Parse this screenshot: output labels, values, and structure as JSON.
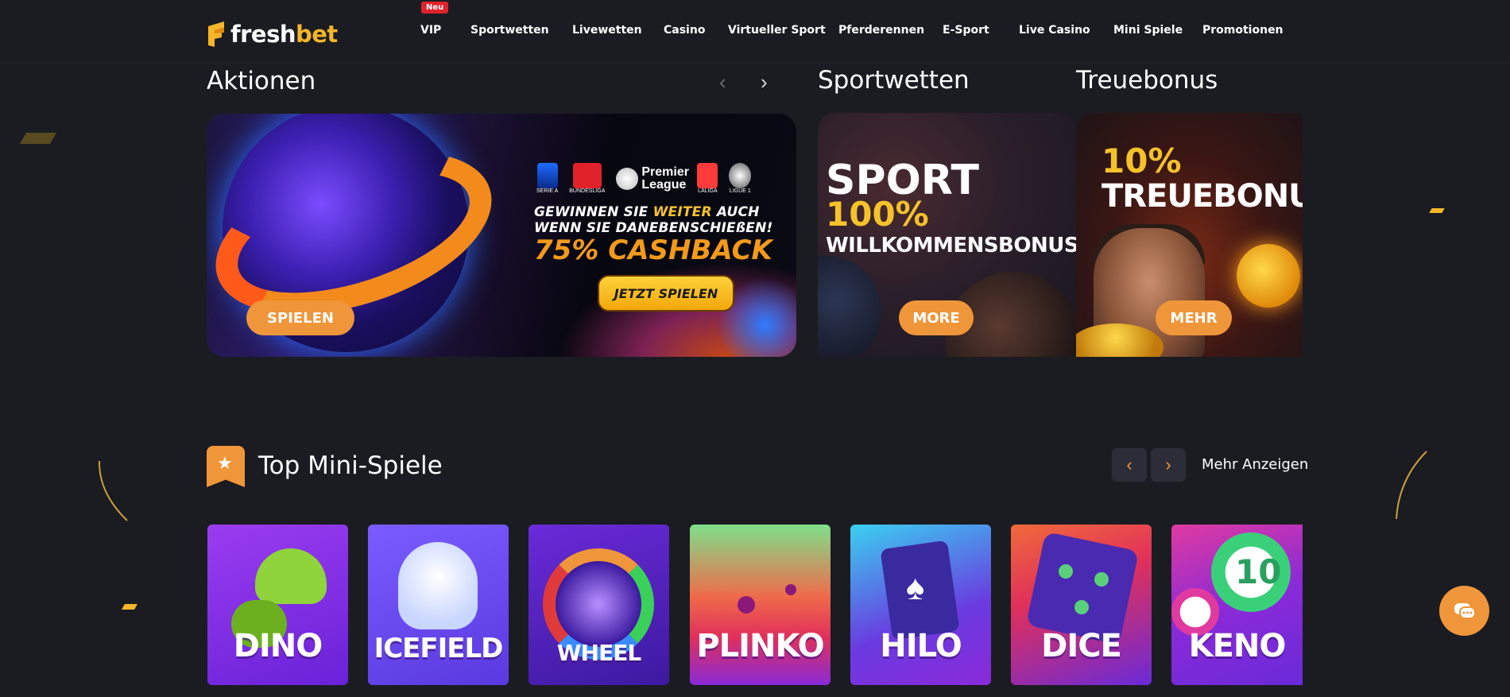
{
  "brand": {
    "logo_fresh": "fresh",
    "logo_bet": "bet"
  },
  "nav": {
    "badge": "Neu",
    "items": [
      "VIP",
      "Sportwetten",
      "Livewetten",
      "Casino",
      "Virtueller Sport",
      "Pferderennen",
      "E-Sport",
      "Live Casino",
      "Mini Spiele",
      "Promotionen"
    ]
  },
  "aktionen": {
    "title": "Aktionen",
    "main_banner": {
      "leagues": [
        "SERIE A",
        "BUNDESLIGA",
        "Premier League",
        "LALIGA",
        "LIGUE 1"
      ],
      "line1": "GEWINNEN SIE WEITER AUCH",
      "line1_highlight": "WEITER",
      "line2": "WENN SIE DANEBENSCHIEßEN!",
      "cashback": "75% CASHBACK",
      "cta": "JETZT SPIELEN",
      "button": "SPIELEN"
    }
  },
  "sportwetten": {
    "title": "Sportwetten",
    "line1": "SPORT",
    "line2": "100%",
    "line3": "WILLKOMMENSBONUS",
    "button": "MORE"
  },
  "treuebonus": {
    "title": "Treuebonus",
    "line1": "10%",
    "line2": "TREUEBONUS",
    "button": "MEHR"
  },
  "mini": {
    "title": "Top Mini-Spiele",
    "more": "Mehr Anzeigen",
    "games": [
      {
        "name": "DINO"
      },
      {
        "name": "ICEFIELD"
      },
      {
        "name": "WHEEL"
      },
      {
        "name": "PLINKO"
      },
      {
        "name": "HILO"
      },
      {
        "name": "DICE"
      },
      {
        "name": "KENO"
      }
    ]
  },
  "colors": {
    "bg": "#1b1c22",
    "accent": "#f0963a",
    "badge": "#e1222a",
    "gold": "#f5b62a"
  },
  "icons": [
    "logo-icon",
    "chevron-left-icon",
    "chevron-right-icon",
    "star-icon",
    "chat-icon"
  ]
}
